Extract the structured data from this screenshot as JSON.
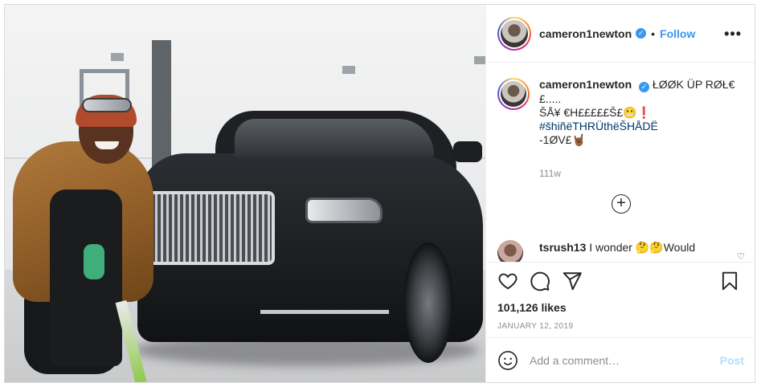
{
  "post": {
    "photo_alt": "Person crouching beside a black Rolls-Royce in a garage",
    "author": {
      "username": "cameron1newton",
      "verified": true,
      "follow_label": "Follow"
    },
    "more_label": "•••",
    "caption": {
      "username": "cameron1newton",
      "line1": "ŁØØK ÜP RØŁ€ £.....",
      "line2": "ŠÅ¥ €H£££££Š£😬❗",
      "hashtag": "#šhiñëTHRÜthëŠHÅDË",
      "line4": "-1ØV£🤘🏾"
    },
    "caption_age": "111w",
    "load_more_icon": "plus-circle-icon",
    "comments": [
      {
        "username": "tsrush13",
        "text": "I wonder 🤔🤔Would"
      }
    ],
    "likes": "101,126 likes",
    "date": "JANUARY 12, 2019",
    "add_comment_placeholder": "Add a comment…",
    "post_button_label": "Post",
    "colors": {
      "accent": "#3897f0",
      "post_disabled": "#b2dffc",
      "muted": "#8e8e8e",
      "text": "#262626"
    }
  }
}
